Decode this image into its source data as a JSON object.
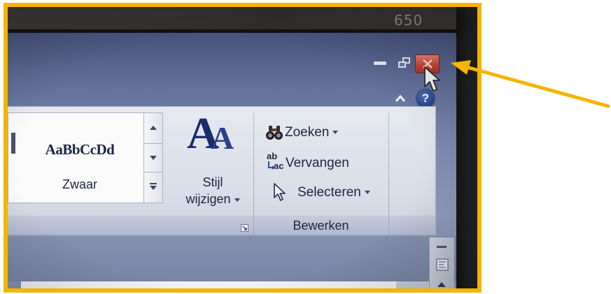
{
  "monitor": {
    "label": "650"
  },
  "window": {
    "controls": [
      {
        "name": "minimize",
        "icon": "minimize-icon"
      },
      {
        "name": "restore",
        "icon": "restore-icon"
      },
      {
        "name": "close",
        "icon": "close-icon",
        "color": "#c8473a"
      }
    ]
  },
  "mouse_pointer_icon": "mouse-pointer-icon",
  "ribbon": {
    "collapse_icon": "chevron-up-icon",
    "help": {
      "label": "?",
      "icon": "help-icon",
      "color": "#2a4a8f"
    },
    "styles": {
      "gallery_item": {
        "sample": "AaBbCcDd",
        "name": "Zwaar"
      },
      "scroll_controls": [
        "scroll-up-icon",
        "scroll-down-icon",
        "gallery-more-icon"
      ],
      "change_styles": {
        "icon": "change-styles-icon",
        "icon_letters": [
          "A",
          "A"
        ],
        "label_line1": "Stijl",
        "label_line2": "wijzigen",
        "has_dropdown": true
      },
      "dialog_launcher_icon": "dialog-launcher-icon"
    },
    "editing": {
      "group_label": "Bewerken",
      "find": {
        "label": "Zoeken",
        "icon": "binoculars-icon",
        "has_dropdown": true
      },
      "replace": {
        "label": "Vervangen",
        "icon": "replace-icon",
        "icon_letters": [
          "ab",
          "ac"
        ]
      },
      "select": {
        "label": "Selecteren",
        "icon": "select-cursor-icon",
        "has_dropdown": true
      }
    }
  },
  "colors": {
    "annotation": "#f5b400",
    "ribbon_text": "#1e2540",
    "title_bar": "#6a78a0"
  }
}
